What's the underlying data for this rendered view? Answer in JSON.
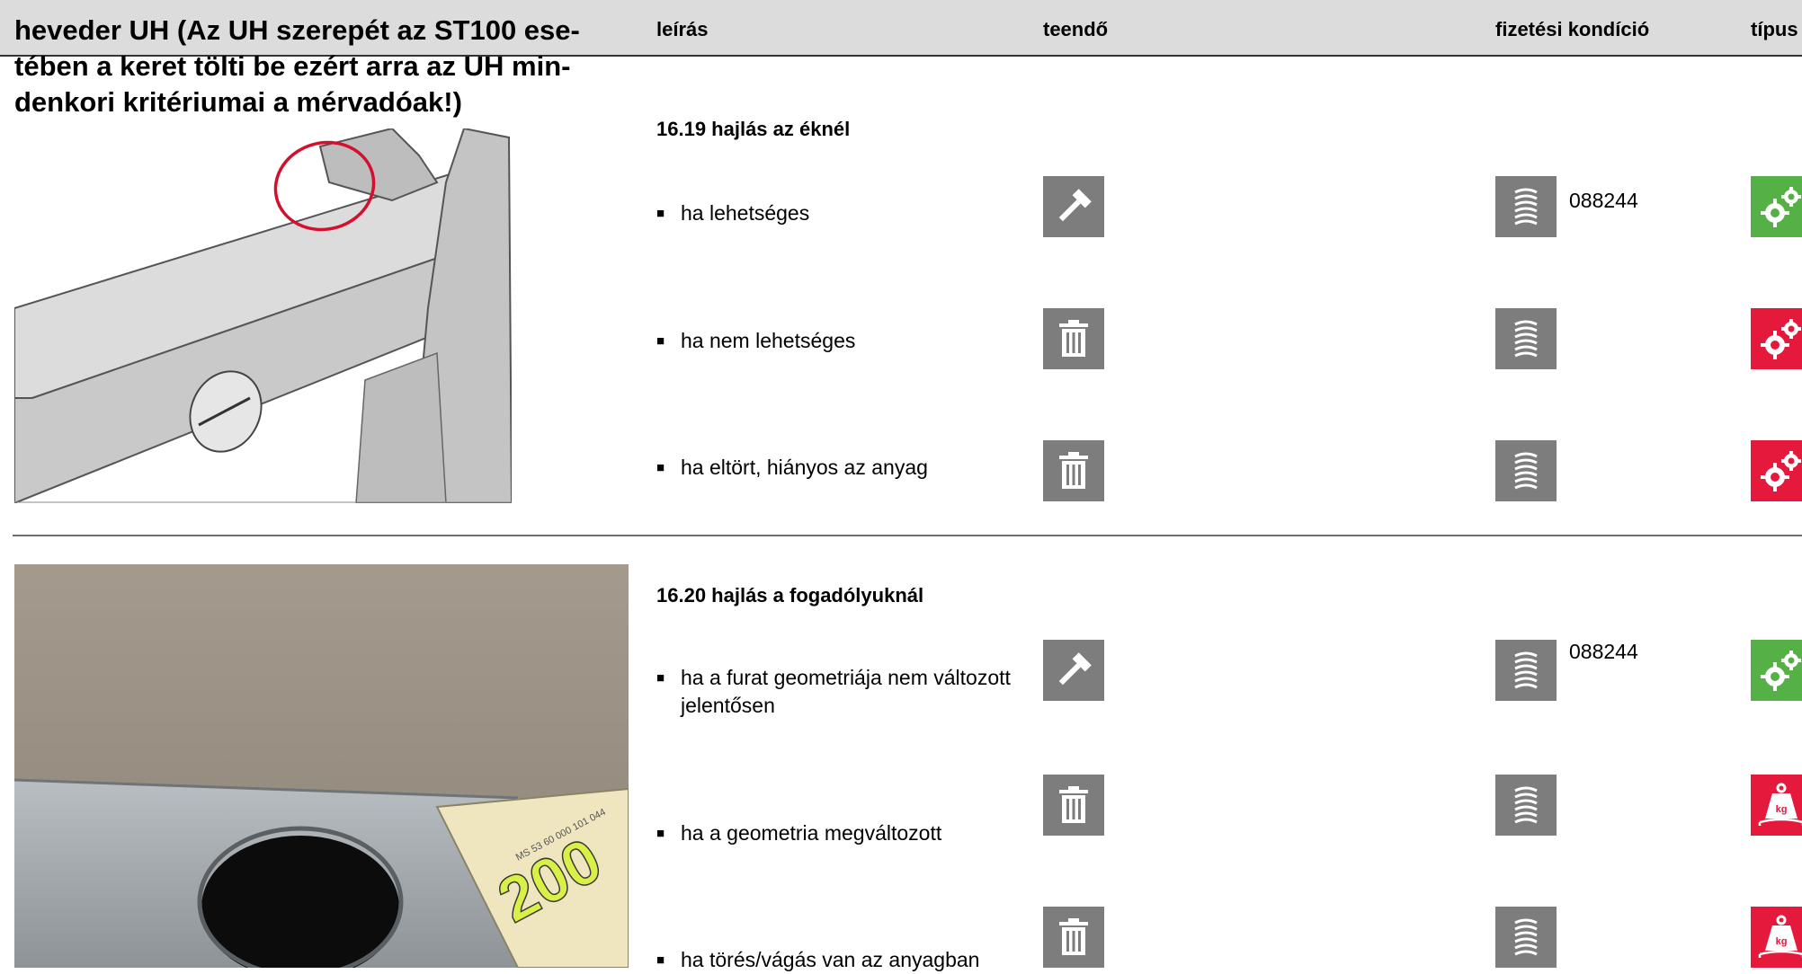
{
  "header": {
    "title": "heveder UH (Az UH szerepét az ST100 ese-tében a keret tölti be ezért arra az UH min-denkori kritériumai a mérvadóak!)",
    "col_description": "leírás",
    "col_action": "teendő",
    "col_payment": "fizetési kondíció",
    "col_type": "típus"
  },
  "sections": [
    {
      "title": "16.19 hajlás az éknél",
      "rows": [
        {
          "text": "ha lehetséges",
          "action_icon": "hammer-icon",
          "payment_icon": "coin-stack-icon",
          "code": "088244",
          "type_icon": "gears-icon",
          "type_color": "#55b046"
        },
        {
          "text": "ha nem lehetséges",
          "action_icon": "trash-icon",
          "payment_icon": "coin-stack-icon",
          "code": "",
          "type_icon": "gears-icon",
          "type_color": "#e4193c"
        },
        {
          "text": "ha eltört, hiányos az anyag",
          "action_icon": "trash-icon",
          "payment_icon": "coin-stack-icon",
          "code": "",
          "type_icon": "gears-icon",
          "type_color": "#e4193c"
        }
      ]
    },
    {
      "title": "16.20 hajlás a fogadólyuknál",
      "rows": [
        {
          "text": "ha a furat geometriája nem változott jelentősen",
          "action_icon": "hammer-icon",
          "payment_icon": "coin-stack-icon",
          "code": "088244",
          "type_icon": "gears-icon",
          "type_color": "#55b046"
        },
        {
          "text": "ha a geometria megváltozott",
          "action_icon": "trash-icon",
          "payment_icon": "coin-stack-icon",
          "code": "",
          "type_icon": "weight-kg-icon",
          "type_color": "#e4193c",
          "weight_label": "kg"
        },
        {
          "text": "ha törés/vágás van az anyagban",
          "action_icon": "trash-icon",
          "payment_icon": "coin-stack-icon",
          "code": "",
          "type_icon": "weight-kg-icon",
          "type_color": "#e4193c",
          "weight_label": "kg"
        }
      ]
    }
  ],
  "photo2": {
    "sticker_text": "200",
    "label_text": "MS 53 60 000 101 044"
  }
}
